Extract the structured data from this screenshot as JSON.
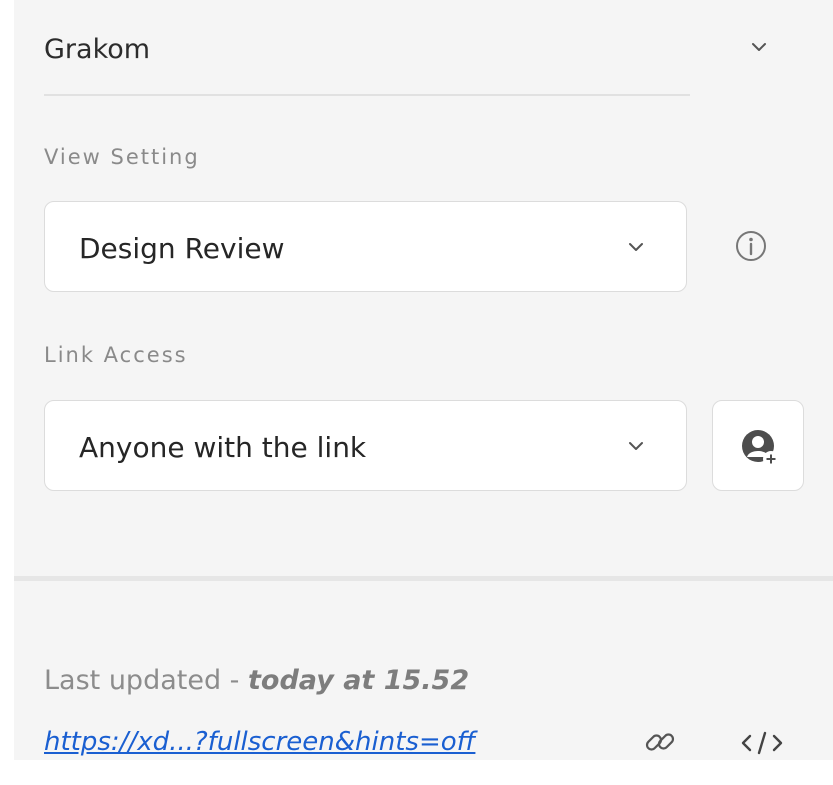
{
  "workspace": {
    "name": "Grakom"
  },
  "view_setting": {
    "label": "View Setting",
    "selected": "Design Review"
  },
  "link_access": {
    "label": "Link Access",
    "selected": "Anyone with the link"
  },
  "footer": {
    "last_updated_prefix": "Last updated - ",
    "last_updated_time": "today at 15.52",
    "url": "https://xd...?fullscreen&hints=off"
  },
  "icons": {
    "workspace_dropdown": "chevron-down-icon",
    "view_dropdown": "chevron-down-icon",
    "link_dropdown": "chevron-down-icon",
    "info": "info-icon",
    "share_user": "user-add-icon",
    "copy_link": "link-icon",
    "embed": "code-icon"
  },
  "colors": {
    "panel_bg": "#f5f5f5",
    "link": "#1a5fd1",
    "muted_text": "#8a8a8a",
    "border": "#dcdcdc"
  }
}
